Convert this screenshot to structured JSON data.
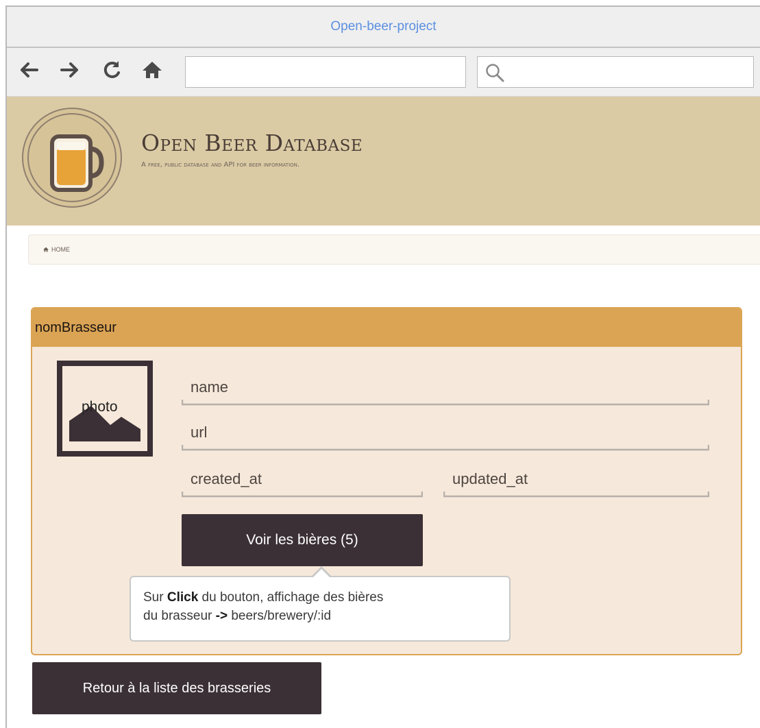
{
  "window": {
    "title": "Open-beer-project"
  },
  "browser": {
    "nav_icons": [
      "arrow-left-icon",
      "arrow-right-icon",
      "reload-icon",
      "home-icon"
    ],
    "url_value": "",
    "search_value": ""
  },
  "header": {
    "title": "Open Beer Database",
    "tagline": "A free, public database and API for beer information."
  },
  "breadcrumb": {
    "home_label": "HOME"
  },
  "panel": {
    "heading": "nomBrasseur",
    "photo_label": "photo",
    "fields": {
      "name": "name",
      "url": "url",
      "created_at": "created_at",
      "updated_at": "updated_at"
    },
    "voir_button_label": "Voir les bières (5)",
    "tooltip": {
      "prefix": "Sur ",
      "bold": "Click",
      "line1_rest": " du bouton, affichage des bières",
      "line2_prefix": "du brasseur ",
      "line2_arrow": "->",
      "line2_rest": " beers/brewery/:id"
    }
  },
  "back_button_label": "Retour à la liste des brasseries",
  "colors": {
    "header_bg": "#dbcba5",
    "panel_heading_bg": "#dba454",
    "panel_body_bg": "#f6e9db",
    "button_bg": "#3b3035",
    "title_link": "#5b8fe0"
  }
}
